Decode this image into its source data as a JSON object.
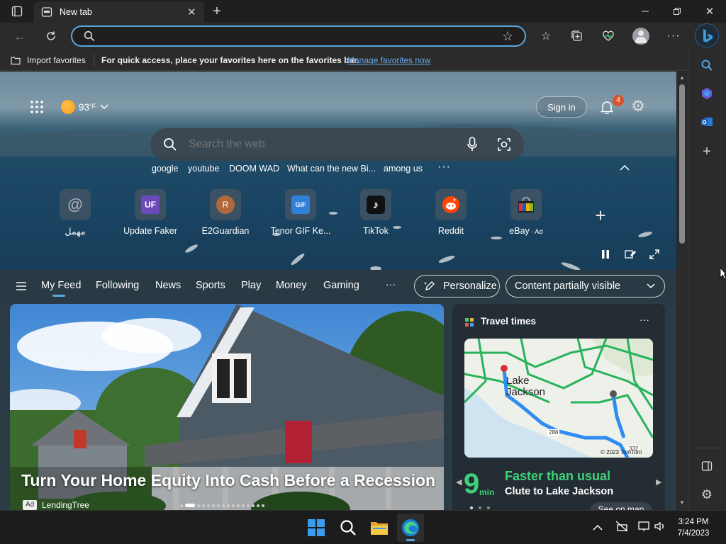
{
  "browser": {
    "tab_title": "New tab",
    "address_value": "",
    "import_favorites": "Import favorites",
    "favbar_message": "For quick access, place your favorites here on the favorites bar.",
    "favbar_link": "Manage favorites now"
  },
  "weather": {
    "temp": "93",
    "unit": "°F"
  },
  "header": {
    "sign_in": "Sign in",
    "notification_count": "4"
  },
  "search": {
    "placeholder": "Search the web"
  },
  "quick_searches": [
    "google",
    "youtube",
    "DOOM WAD",
    "What can the new Bi...",
    "among us"
  ],
  "tiles": [
    {
      "label": "مهمل",
      "glyph": "@",
      "color": "#5a6168",
      "icon": "at-sign-icon"
    },
    {
      "label": "Update Faker",
      "glyph": "UF",
      "color": "#6b4bb8",
      "icon": "uf-logo-icon"
    },
    {
      "label": "E2Guardian",
      "glyph": "R",
      "color": "#b0673a",
      "icon": "r-avatar-icon"
    },
    {
      "label": "Tenor GIF Ke...",
      "glyph": "GIF",
      "color": "#2f7fd6",
      "icon": "tenor-gif-icon"
    },
    {
      "label": "TikTok",
      "glyph": "♪",
      "color": "#111111",
      "icon": "tiktok-icon"
    },
    {
      "label": "Reddit",
      "glyph": "●",
      "color": "#ff4500",
      "icon": "reddit-icon"
    },
    {
      "label": "eBay",
      "ad": "· Ad",
      "glyph": "▦",
      "color": "#222222",
      "icon": "ebay-bag-icon"
    }
  ],
  "feed": {
    "items": [
      "My Feed",
      "Following",
      "News",
      "Sports",
      "Play",
      "Money",
      "Gaming"
    ],
    "more": "···",
    "personalize": "Personalize",
    "visibility": "Content partially visible"
  },
  "main_card": {
    "headline": "Turn Your Home Equity Into Cash Before a Recession",
    "ad_badge": "Ad",
    "source": "LendingTree"
  },
  "travel": {
    "title": "Travel times",
    "more": "···",
    "map_place_line1": "Lake",
    "map_place_line2": "Jackson",
    "map_road_1": "288",
    "map_road_2": "332",
    "map_copyright": "© 2023 TomTom",
    "minutes": "9",
    "min_unit": "min",
    "status": "Faster than usual",
    "route": "Clute to Lake Jackson",
    "see_on_map": "See on map"
  },
  "taskbar": {
    "time": "3:24 PM",
    "date": "7/4/2023"
  },
  "colors": {
    "accent": "#3b9bd9",
    "status_green": "#3fd17a",
    "badge": "#d9532c"
  }
}
